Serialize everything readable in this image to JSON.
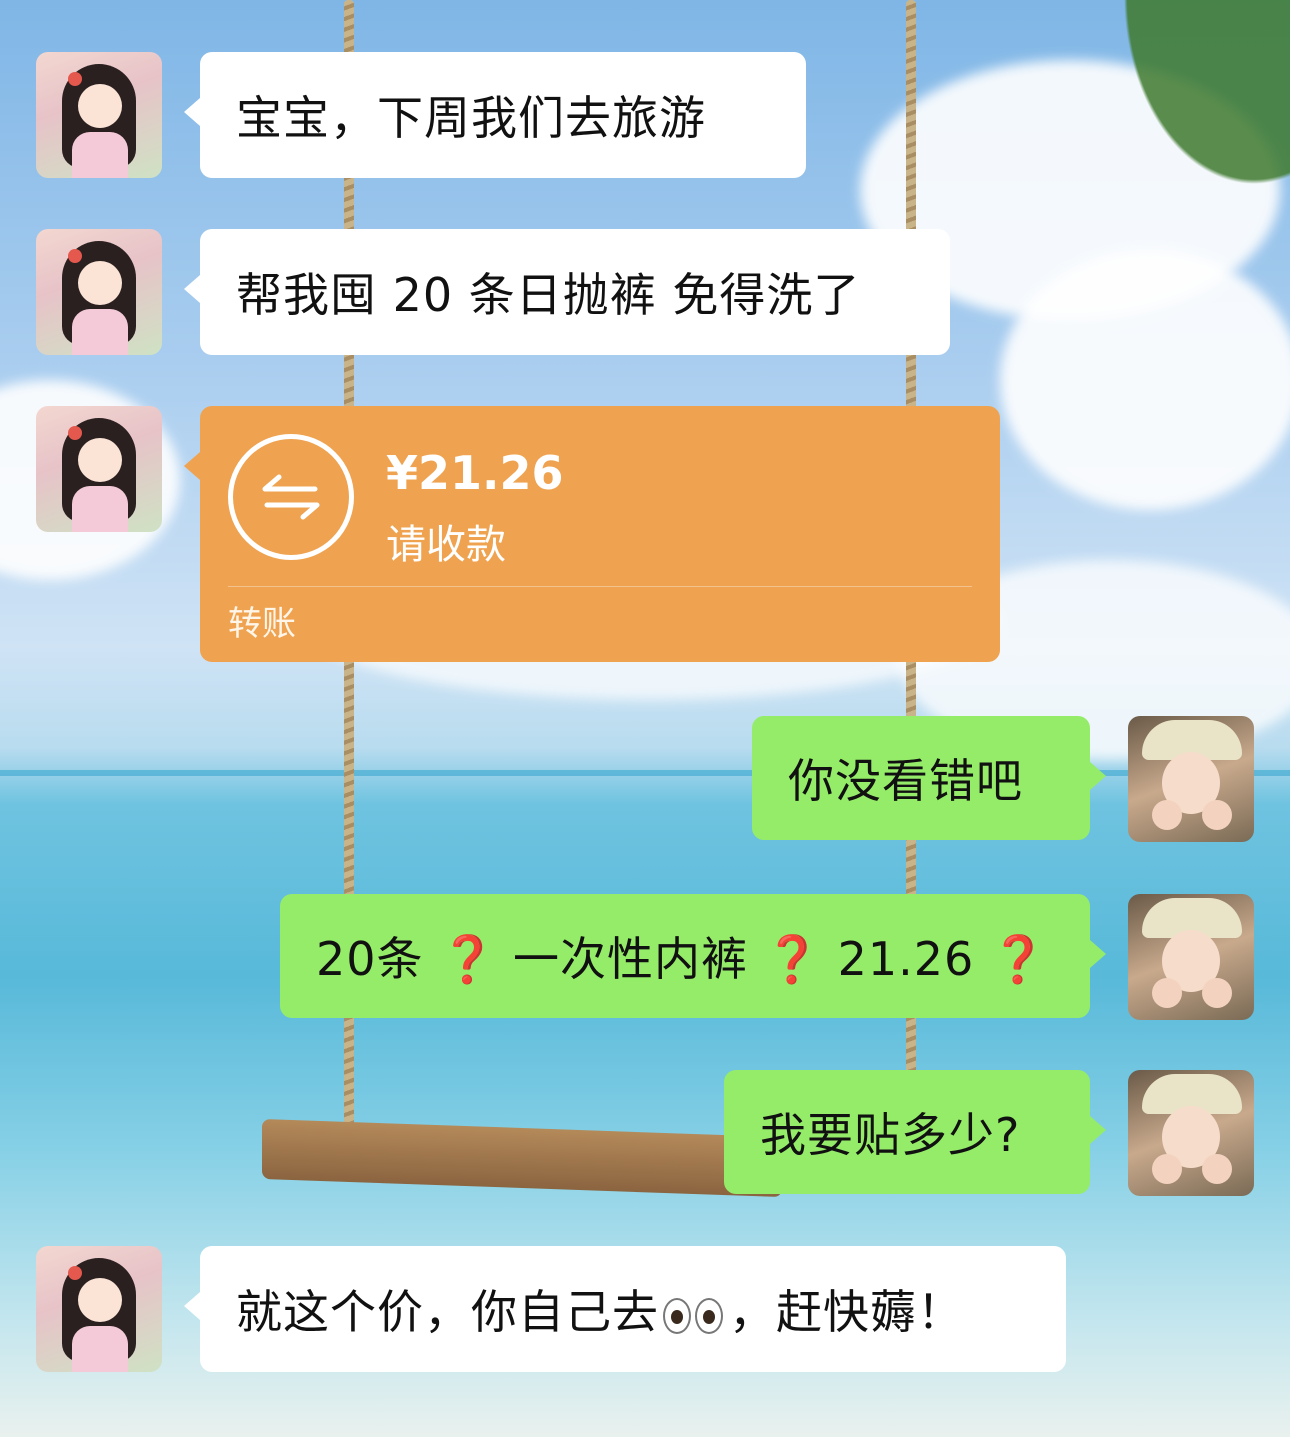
{
  "messages": [
    {
      "side": "left",
      "type": "text",
      "text": "宝宝，下周我们去旅游"
    },
    {
      "side": "left",
      "type": "text",
      "text": "帮我囤 20 条日抛裤 免得洗了"
    },
    {
      "side": "left",
      "type": "transfer",
      "amount": "¥21.26",
      "status": "请收款",
      "kind": "转账"
    },
    {
      "side": "right",
      "type": "text",
      "text": "你没看错吧"
    },
    {
      "side": "right",
      "type": "text",
      "parts": [
        "20条 ",
        "❓",
        " 一次性内裤 ",
        "❓",
        " 21.26 ",
        "❓"
      ]
    },
    {
      "side": "right",
      "type": "text",
      "text": "我要贴多少?"
    },
    {
      "side": "left",
      "type": "text",
      "parts": [
        "就这个价，你自己去",
        "👀",
        "，赶快薅！"
      ]
    }
  ],
  "icons": {
    "transfer_icon": "transfer-arrows-icon",
    "left_avatar": "anime-girl-avatar",
    "right_avatar": "girl-photo-avatar"
  },
  "colors": {
    "bubble_green": "#95ec69",
    "bubble_white": "#ffffff",
    "transfer_orange": "#efa350",
    "question_red": "#e02f2f"
  }
}
